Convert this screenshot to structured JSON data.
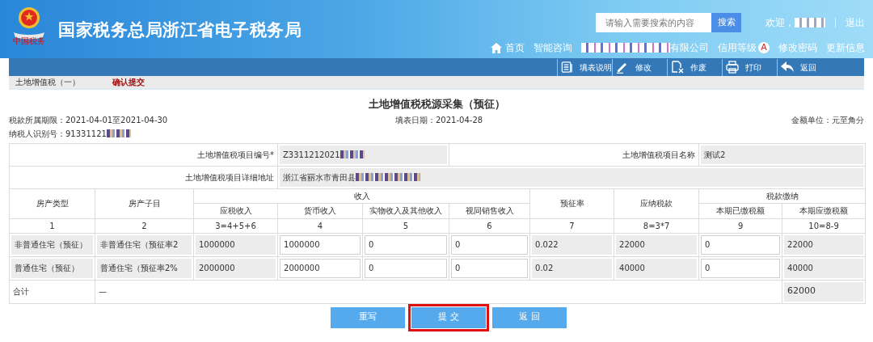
{
  "header": {
    "logo_caption": "中国税务",
    "site_title": "国家税务总局浙江省电子税务局",
    "search": {
      "placeholder": "请输入需要搜索的内容",
      "button": "搜索"
    },
    "welcome": "欢迎，",
    "logout": "退出",
    "nav": [
      {
        "kind": "home",
        "label": "首页"
      },
      {
        "kind": "link",
        "label": "智能咨询"
      },
      {
        "kind": "company",
        "label": "有限公司"
      },
      {
        "kind": "rating",
        "label": "信用等级",
        "badge": "A"
      },
      {
        "kind": "link",
        "label": "修改密码"
      },
      {
        "kind": "link",
        "label": "更新信息"
      }
    ]
  },
  "toolbar": [
    {
      "kind": "doc",
      "label": "填表说明"
    },
    {
      "kind": "pen",
      "label": "修改"
    },
    {
      "kind": "void",
      "label": "作废"
    },
    {
      "kind": "print",
      "label": "打印"
    },
    {
      "kind": "back",
      "label": "返回"
    }
  ],
  "breadcrumb": [
    {
      "label": "土地增值税（一）",
      "selected": false
    },
    {
      "label": "确认提交",
      "selected": true
    }
  ],
  "form": {
    "title": "土地增值税税源采集（预征）",
    "period": "税款所属期限：2021-04-01至2021-04-30",
    "fill_date": "填表日期：2021-04-28",
    "unit": "金额单位：元至角分",
    "taxpayer_id": "纳税人识别号：91331121",
    "project_no_label": "土地增值税项目编号*",
    "project_no": "Z3311212021",
    "project_name_label": "土地增值税项目名称",
    "project_name": "测试2",
    "address_label": "土地增值税项目详细地址",
    "address": "浙江省丽水市青田县"
  },
  "table": {
    "h_type": "房产类型",
    "h_sub": "房产子目",
    "h_income": "收入",
    "h_taxable": "应税收入",
    "h_money": "货币收入",
    "h_kind": "实物收入及其他收入",
    "h_deemed": "视同销售收入",
    "h_rate": "预征率",
    "h_tax": "应纳税款",
    "h_pay": "税款缴纳",
    "h_paid": "本期已缴税额",
    "h_due": "本期应缴税额",
    "col_numbers": [
      "1",
      "2",
      "3=4+5+6",
      "4",
      "5",
      "6",
      "7",
      "8=3*7",
      "9",
      "10=8-9"
    ],
    "rows": [
      {
        "cells": [
          {
            "kind": "readonly",
            "value": "非普通住宅（预征）"
          },
          {
            "kind": "readonly",
            "value": "非普通住宅（预征率2"
          },
          {
            "kind": "readonly",
            "value": "1000000"
          },
          {
            "kind": "input",
            "value": "1000000"
          },
          {
            "kind": "input",
            "value": "0"
          },
          {
            "kind": "input",
            "value": "0"
          },
          {
            "kind": "readonly",
            "value": "0.022"
          },
          {
            "kind": "readonly",
            "value": "22000"
          },
          {
            "kind": "input",
            "value": "0"
          },
          {
            "kind": "readonly",
            "value": "22000"
          }
        ]
      },
      {
        "cells": [
          {
            "kind": "readonly",
            "value": "普通住宅（预征）"
          },
          {
            "kind": "readonly",
            "value": "普通住宅（预征率2%"
          },
          {
            "kind": "readonly",
            "value": "2000000"
          },
          {
            "kind": "input",
            "value": "2000000"
          },
          {
            "kind": "input",
            "value": "0"
          },
          {
            "kind": "input",
            "value": "0"
          },
          {
            "kind": "readonly",
            "value": "0.02"
          },
          {
            "kind": "readonly",
            "value": "40000"
          },
          {
            "kind": "input",
            "value": "0"
          },
          {
            "kind": "readonly",
            "value": "40000"
          }
        ]
      }
    ],
    "total": {
      "label": "合计",
      "dash": "—",
      "value": "62000"
    }
  },
  "buttons": [
    {
      "label": "重写",
      "highlighted": false
    },
    {
      "label": "提 交",
      "highlighted": true
    },
    {
      "label": "返 回",
      "highlighted": false
    }
  ]
}
